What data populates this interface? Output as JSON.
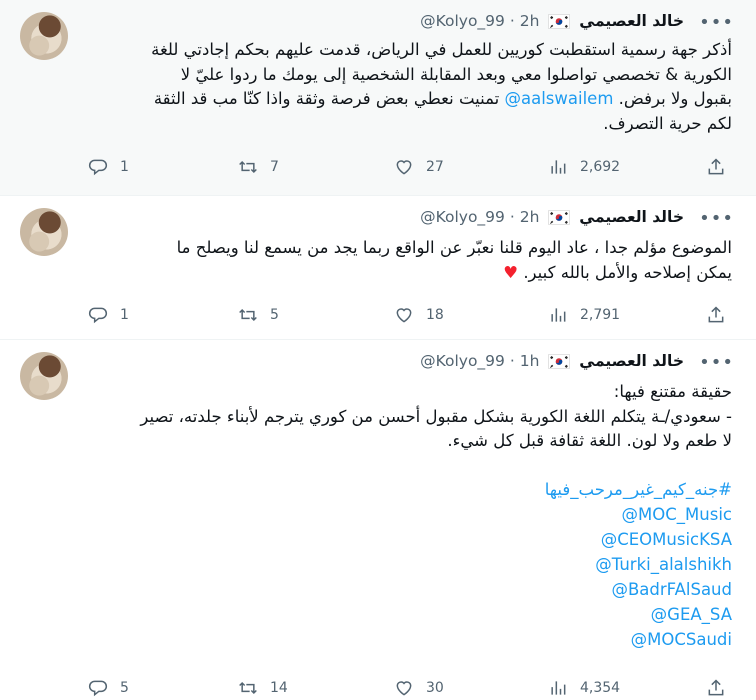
{
  "tweets": [
    {
      "author_name": "خالد العصيمي",
      "handle": "@Kolyo_99",
      "separator": "·",
      "time": "2h",
      "text_lines": [
        "أذكر جهة رسمية استقطبت كوريين للعمل في الرياض، قدمت عليهم بحكم إجادتي للغة",
        "الكورية & تخصصي تواصلوا معي وبعد المقابلة الشخصية إلى يومك ما ردوا عليّ لا"
      ],
      "line3_before": "بقبول ولا برفض.",
      "line3_mention": "@aalswailem",
      "line3_after": "تمنيت نعطي بعض فرصة وثقة واذا كنّا مب قد الثقة",
      "line4": "لكم حرية التصرف.",
      "replies": "1",
      "retweets": "7",
      "likes": "27",
      "views": "2,692"
    },
    {
      "author_name": "خالد العصيمي",
      "handle": "@Kolyo_99",
      "separator": "·",
      "time": "2h",
      "text_lines": [
        "الموضوع مؤلم جدا ، عاد اليوم قلنا نعبّر عن الواقع ربما يجد من يسمع لنا ويصلح ما",
        "يمكن إصلاحه والأمل بالله كبير."
      ],
      "heart_emoji": "♥",
      "replies": "1",
      "retweets": "5",
      "likes": "18",
      "views": "2,791"
    },
    {
      "author_name": "خالد العصيمي",
      "handle": "@Kolyo_99",
      "separator": "·",
      "time": "1h",
      "text_lines": [
        "حقيقة مقتنع فيها:",
        "- سعودي/ـة يتكلم اللغة الكورية بشكل مقبول أحسن من كوري يترجم لأبناء جلدته، تصير",
        "لا طعم ولا لون. اللغة ثقافة قبل كل شيء."
      ],
      "hashtag": "#جنه_كيم_غير_مرحب_فيها",
      "mentions": [
        "@MOC_Music",
        "@CEOMusicKSA",
        "@Turki_alalshikh",
        "@BadrFAlSaud",
        "@GEA_SA",
        "@MOCSaudi"
      ],
      "replies": "5",
      "retweets": "14",
      "likes": "30",
      "views": "4,354"
    }
  ],
  "icons": {
    "more": "more-horizontal-icon",
    "reply": "reply-bubble-icon",
    "retweet": "retweet-icon",
    "like": "heart-icon",
    "views": "views-bar-icon",
    "share": "share-upload-icon",
    "flag": "south-korea-flag-icon"
  },
  "colors": {
    "link": "#1d9bf0",
    "muted": "#536471",
    "text": "#0f1419",
    "heart": "#f4212e"
  }
}
